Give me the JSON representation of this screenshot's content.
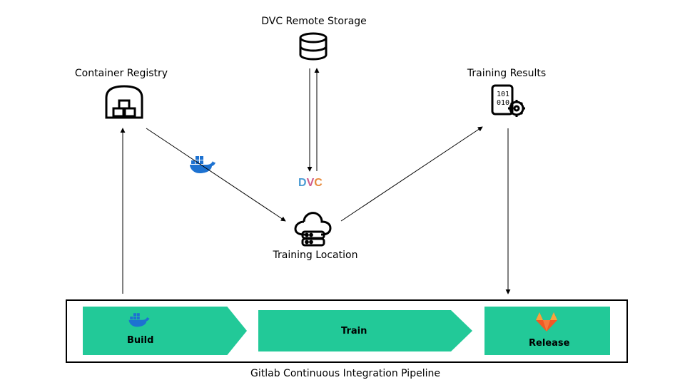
{
  "nodes": {
    "registry": {
      "label": "Container Registry"
    },
    "dvc_storage": {
      "label": "DVC Remote Storage"
    },
    "training_results": {
      "label": "Training Results"
    },
    "training_location": {
      "label": "Training Location"
    },
    "dvc_logo": {
      "text": "DVC"
    }
  },
  "pipeline": {
    "build": {
      "label": "Build"
    },
    "train": {
      "label": "Train"
    },
    "release": {
      "label": "Release"
    },
    "caption": "Gitlab Continuous Integration Pipeline"
  },
  "chart_data": {
    "type": "diagram",
    "nodes": [
      {
        "id": "registry",
        "label": "Container Registry",
        "icon": "warehouse"
      },
      {
        "id": "dvc_storage",
        "label": "DVC Remote Storage",
        "icon": "database"
      },
      {
        "id": "training_results",
        "label": "Training Results",
        "icon": "report-gear"
      },
      {
        "id": "training_location",
        "label": "Training Location",
        "icon": "cloud-server"
      },
      {
        "id": "pipeline",
        "label": "Gitlab Continuous Integration Pipeline",
        "steps": [
          "Build",
          "Train",
          "Release"
        ]
      }
    ],
    "edges": [
      {
        "from": "pipeline.build",
        "to": "registry",
        "dir": "up"
      },
      {
        "from": "registry",
        "to": "training_location",
        "dir": "down-right",
        "icon": "docker"
      },
      {
        "from": "dvc_storage",
        "to": "training_location",
        "dir": "bidirectional",
        "icon": "dvc"
      },
      {
        "from": "training_location",
        "to": "training_results",
        "dir": "up-right"
      },
      {
        "from": "training_results",
        "to": "pipeline.release",
        "dir": "down"
      }
    ]
  },
  "colors": {
    "accent": "#22c998",
    "docker_blue": "#1d72d1",
    "gitlab_orange": "#f25925",
    "dvc_blue": "#4b9bd3",
    "dvc_pink": "#d15b8a",
    "dvc_orange": "#e78a3c"
  }
}
